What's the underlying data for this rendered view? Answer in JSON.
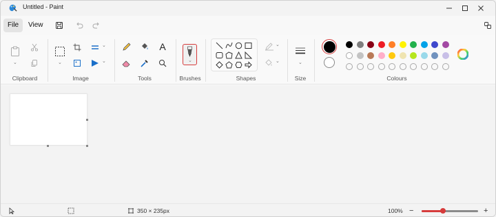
{
  "window": {
    "title": "Untitled - Paint"
  },
  "menu": {
    "file_label": "File",
    "view_label": "View"
  },
  "ribbon": {
    "groups": {
      "clipboard": "Clipboard",
      "image": "Image",
      "tools": "Tools",
      "brushes": "Brushes",
      "shapes": "Shapes",
      "size": "Size",
      "colours": "Colours"
    }
  },
  "colours": {
    "primary": "#000000",
    "secondary": "#ffffff",
    "row1": [
      "#000000",
      "#7f7f7f",
      "#880015",
      "#ed1c24",
      "#ff7f27",
      "#fff200",
      "#22b14c",
      "#00a2e8",
      "#3f48cc",
      "#a349a4"
    ],
    "row2": [
      "#ffffff",
      "#c3c3c3",
      "#b97a57",
      "#ffaec9",
      "#ffc90e",
      "#efe4b0",
      "#b5e61d",
      "#99d9ea",
      "#7092be",
      "#c8bfe7"
    ],
    "row3_empty_count": 10
  },
  "status": {
    "canvas_size": "350 × 235px",
    "zoom": "100%",
    "zoom_level_percent": 100
  }
}
